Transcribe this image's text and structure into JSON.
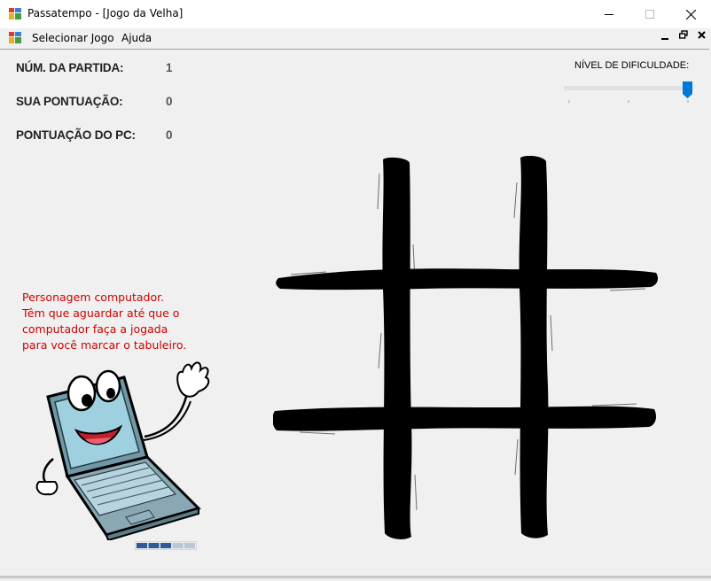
{
  "window": {
    "title": "Passatempo - [Jogo da Velha]",
    "icons": {
      "app": "app-icon",
      "minimize": "minimize-icon",
      "maximize": "maximize-icon",
      "close": "close-icon"
    }
  },
  "menu": {
    "items": [
      {
        "label": "Selecionar Jogo"
      },
      {
        "label": "Ajuda"
      }
    ],
    "mdi_controls": [
      {
        "icon": "mdi-minimize-icon"
      },
      {
        "icon": "mdi-restore-icon"
      },
      {
        "icon": "mdi-close-icon"
      }
    ]
  },
  "stats": {
    "match_label": "NÚM. DA PARTIDA:",
    "match_value": "1",
    "your_score_label": "SUA  PONTUAÇÃO:",
    "your_score_value": "0",
    "pc_score_label": "PONTUAÇÃO DO PC:",
    "pc_score_value": "0"
  },
  "difficulty": {
    "label": "NÍVEL DE DIFICULDADE:",
    "level_fraction": 1.0,
    "accent": "#0078d7"
  },
  "character": {
    "lines": [
      "Personagem computador.",
      "Têm que aguardar até que o",
      "computador faça a jogada",
      "para você marcar o tabuleiro."
    ],
    "text_color": "#d00000",
    "icon": "laptop-mascot-icon"
  },
  "progress": {
    "filled_segments": 3,
    "total_segments": 5,
    "color": "#2e5a9c"
  },
  "board": {
    "icon": "tic-tac-toe-grid-icon",
    "cells": [
      "",
      "",
      "",
      "",
      "",
      "",
      "",
      "",
      ""
    ]
  }
}
